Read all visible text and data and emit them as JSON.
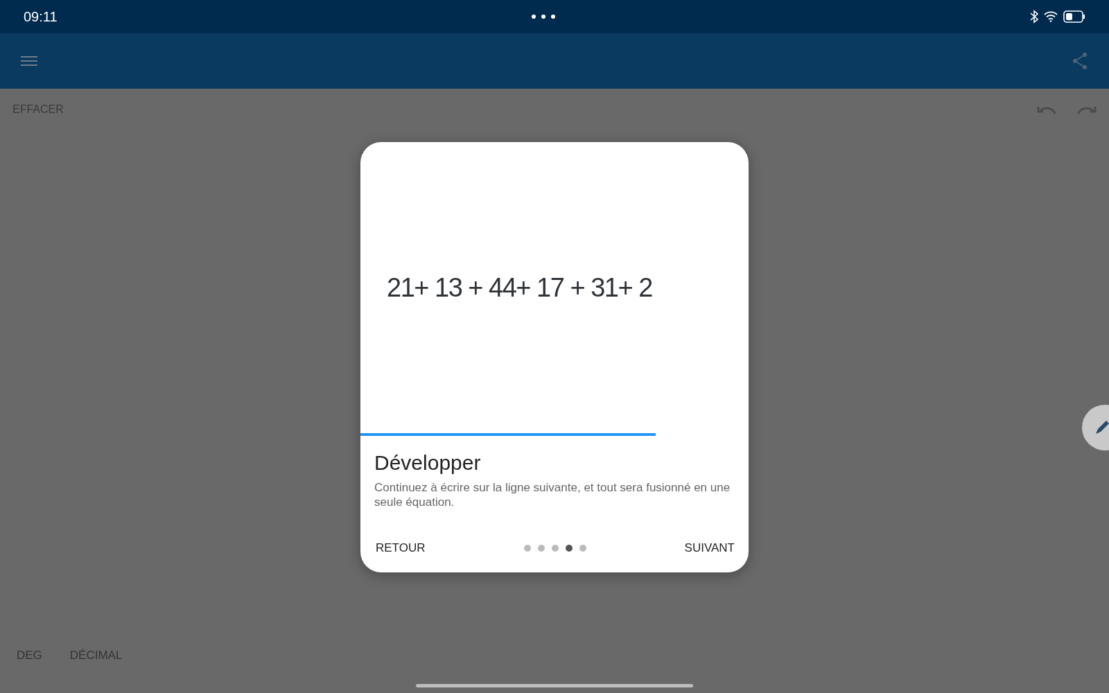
{
  "status_bar": {
    "time": "09:11"
  },
  "toolbar": {
    "clear_label": "EFFACER"
  },
  "bottom_bar": {
    "modes": [
      "DEG",
      "DÉCIMAL"
    ]
  },
  "dialog": {
    "expression": "21+ 13 + 44+ 17 + 31+ 2",
    "progress": {
      "level": 0.76
    },
    "title": "Développer",
    "description": "Continuez à écrire sur la ligne suivante, et tout sera fusionné en une seule équation.",
    "back_label": "RETOUR",
    "next_label": "SUIVANT",
    "pages": [
      {
        "selected": false
      },
      {
        "selected": false
      },
      {
        "selected": false
      },
      {
        "selected": true
      },
      {
        "selected": false
      }
    ]
  }
}
